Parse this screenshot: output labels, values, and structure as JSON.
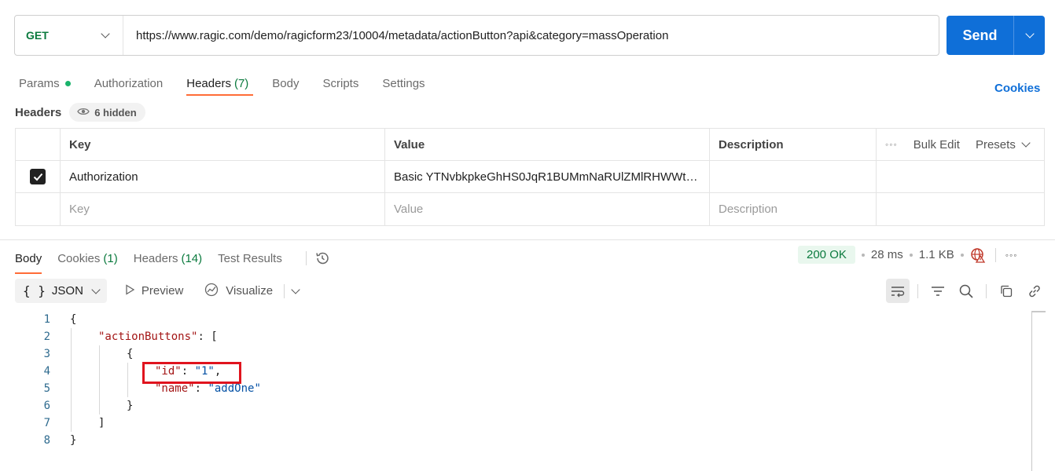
{
  "request": {
    "method": "GET",
    "url": "https://www.ragic.com/demo/ragicform23/10004/metadata/actionButton?api&category=massOperation",
    "send_label": "Send"
  },
  "request_tabs": {
    "params": "Params",
    "authorization": "Authorization",
    "headers": "Headers",
    "headers_count": "(7)",
    "body": "Body",
    "scripts": "Scripts",
    "settings": "Settings",
    "cookies_link": "Cookies"
  },
  "headers_section": {
    "title": "Headers",
    "hidden_label": "6 hidden"
  },
  "header_table": {
    "columns": {
      "key": "Key",
      "value": "Value",
      "description": "Description"
    },
    "bulk_edit": "Bulk Edit",
    "presets": "Presets",
    "rows": [
      {
        "checked": true,
        "key": "Authorization",
        "value": "Basic YTNvbkpkeGhHS0JqR1BUMmNaRUlZMlRHWWt…",
        "description": ""
      }
    ],
    "placeholder": {
      "key": "Key",
      "value": "Value",
      "description": "Description"
    }
  },
  "response_tabs": {
    "body": "Body",
    "cookies": "Cookies",
    "cookies_count": "(1)",
    "headers": "Headers",
    "headers_count": "(14)",
    "test_results": "Test Results"
  },
  "response_status": {
    "status": "200 OK",
    "time": "28 ms",
    "size": "1.1 KB"
  },
  "response_toolbar": {
    "format": "JSON",
    "preview": "Preview",
    "visualize": "Visualize"
  },
  "code_lines": [
    {
      "num": "1",
      "text": "{"
    },
    {
      "num": "2",
      "key": "\"actionButtons\"",
      "rest": ": ["
    },
    {
      "num": "3",
      "text": "{"
    },
    {
      "num": "4",
      "key": "\"id\"",
      "rest": ": ",
      "str": "\"1\"",
      "tail": ","
    },
    {
      "num": "5",
      "key": "\"name\"",
      "rest": ": ",
      "str": "\"addOne\""
    },
    {
      "num": "6",
      "text": "}"
    },
    {
      "num": "7",
      "text": "]"
    },
    {
      "num": "8",
      "text": "}"
    }
  ],
  "colors": {
    "accent": "#ff6c37",
    "send": "#0f6fd8",
    "success": "#0b7a3e",
    "highlight_box": "#e0141e"
  }
}
